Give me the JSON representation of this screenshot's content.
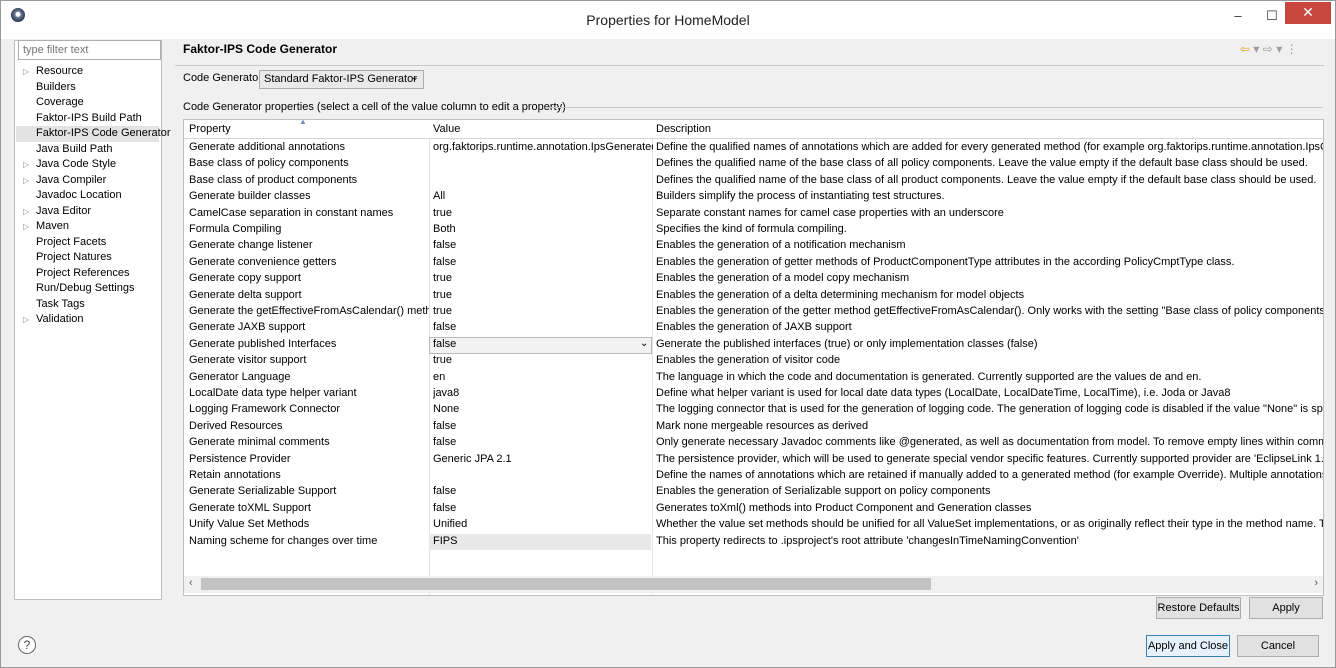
{
  "window": {
    "title": "Properties for HomeModel",
    "min": "–",
    "max": "☐",
    "close": "✕"
  },
  "sidebar": {
    "filter_placeholder": "type filter text",
    "items": [
      {
        "label": "Resource",
        "expandable": true
      },
      {
        "label": "Builders",
        "expandable": false
      },
      {
        "label": "Coverage",
        "expandable": false
      },
      {
        "label": "Faktor-IPS Build Path",
        "expandable": false
      },
      {
        "label": "Faktor-IPS Code Generator",
        "expandable": false,
        "selected": true
      },
      {
        "label": "Java Build Path",
        "expandable": false
      },
      {
        "label": "Java Code Style",
        "expandable": true
      },
      {
        "label": "Java Compiler",
        "expandable": true
      },
      {
        "label": "Javadoc Location",
        "expandable": false
      },
      {
        "label": "Java Editor",
        "expandable": true
      },
      {
        "label": "Maven",
        "expandable": true
      },
      {
        "label": "Project Facets",
        "expandable": false
      },
      {
        "label": "Project Natures",
        "expandable": false
      },
      {
        "label": "Project References",
        "expandable": false
      },
      {
        "label": "Run/Debug Settings",
        "expandable": false
      },
      {
        "label": "Task Tags",
        "expandable": false
      },
      {
        "label": "Validation",
        "expandable": true
      }
    ]
  },
  "main": {
    "title": "Faktor-IPS Code Generator",
    "code_generator_label": "Code Generator:",
    "code_generator_value": "Standard Faktor-IPS Generator",
    "properties_label": "Code Generator properties (select a cell of the value column to edit a property)",
    "columns": {
      "property": "Property",
      "value": "Value",
      "description": "Description"
    },
    "rows": [
      {
        "property": "Generate additional annotations",
        "value": "org.faktorips.runtime.annotation.IpsGenerated",
        "description": "Define the qualified names of annotations which are added for every generated method (for example org.faktorips.runtime.annotation.IpsGenerated"
      },
      {
        "property": "Base class of policy components",
        "value": "",
        "description": "Defines the qualified name of the base class of all policy components. Leave the value empty if the default base class should be used."
      },
      {
        "property": "Base class of product components",
        "value": "",
        "description": "Defines the qualified name of the base class of all product components. Leave the value empty if the default base class should be used."
      },
      {
        "property": "Generate builder classes",
        "value": "All",
        "description": "Builders simplify the process of instantiating test structures."
      },
      {
        "property": "CamelCase separation in constant names",
        "value": "true",
        "description": "Separate constant names for camel case properties with an underscore"
      },
      {
        "property": "Formula Compiling",
        "value": "Both",
        "description": "Specifies the kind of formula compiling."
      },
      {
        "property": "Generate change listener",
        "value": "false",
        "description": "Enables the generation of a notification mechanism"
      },
      {
        "property": "Generate convenience getters",
        "value": "false",
        "description": "Enables the generation of getter methods of ProductComponentType attributes in the according PolicyCmptType class."
      },
      {
        "property": "Generate copy support",
        "value": "true",
        "description": "Enables the generation of a model copy mechanism"
      },
      {
        "property": "Generate delta support",
        "value": "true",
        "description": "Enables the generation of a delta determining mechanism for model objects"
      },
      {
        "property": "Generate the getEffectiveFromAsCalendar() method",
        "value": "true",
        "description": "Enables the generation of the getter method getEffectiveFromAsCalendar(). Only works with the setting \"Base class of policy components\"."
      },
      {
        "property": "Generate JAXB support",
        "value": "false",
        "description": "Enables the generation of JAXB support"
      },
      {
        "property": "Generate published Interfaces",
        "value": "false",
        "description": "Generate the published interfaces (true) or only implementation classes (false)",
        "editing": true
      },
      {
        "property": "Generate visitor support",
        "value": "true",
        "description": "Enables the generation of visitor code"
      },
      {
        "property": "Generator Language",
        "value": "en",
        "description": "The language in which the code and documentation is generated. Currently supported are the values de and en."
      },
      {
        "property": "LocalDate data type helper variant",
        "value": "java8",
        "description": "Define what helper variant is used for local date data types (LocalDate, LocalDateTime, LocalTime), i.e. Joda or Java8"
      },
      {
        "property": "Logging Framework Connector",
        "value": "None",
        "description": "The logging connector that is used for the generation of logging code. The generation of logging code is disabled if the value \"None\" is specified. F"
      },
      {
        "property": "Derived Resources",
        "value": "false",
        "description": "Mark none mergeable resources as derived"
      },
      {
        "property": "Generate minimal comments",
        "value": "false",
        "description": "Only generate necessary Javadoc comments like @generated, as well as documentation from model. To remove empty lines within comments, acti"
      },
      {
        "property": "Persistence Provider",
        "value": "Generic JPA 2.1",
        "description": "The persistence provider, which will be used to generate special vendor specific features. Currently supported provider are 'EclipseLink 1.1', 'EclipseL"
      },
      {
        "property": "Retain annotations",
        "value": "",
        "description": "Define the names of annotations which are retained if manually added to a generated method (for example Override). Multiple annotations are sepa"
      },
      {
        "property": "Generate Serializable Support",
        "value": "false",
        "description": "Enables the generation of Serializable support on policy components"
      },
      {
        "property": "Generate toXML Support",
        "value": "false",
        "description": "Generates toXml() methods into Product Component and Generation classes"
      },
      {
        "property": "Unify Value Set Methods",
        "value": "Unified",
        "description": "Whether the value set methods should be unified for all ValueSet implementations, or as originally reflect their type in the method name. The three"
      },
      {
        "property": "Naming scheme for changes over time",
        "value": "FIPS",
        "description": "This property redirects to .ipsproject's root attribute 'changesInTimeNamingConvention'",
        "disabled": true
      }
    ]
  },
  "buttons": {
    "restore": "Restore Defaults",
    "apply": "Apply",
    "apply_close": "Apply and Close",
    "cancel": "Cancel",
    "help": "?"
  }
}
